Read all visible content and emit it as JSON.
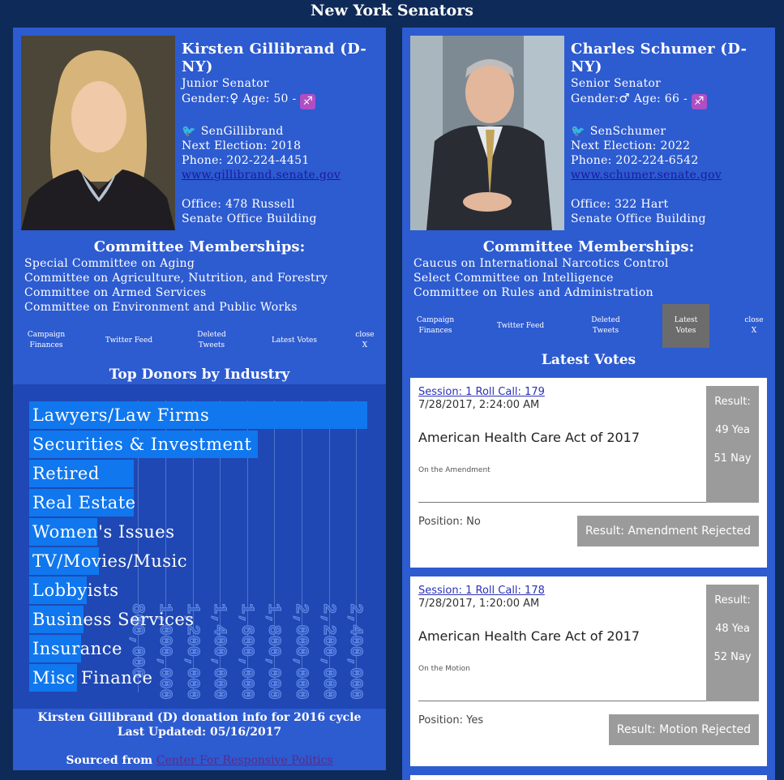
{
  "page_title": "New York Senators",
  "senators": [
    {
      "name": "Kirsten Gillibrand (D-NY)",
      "rank": "Junior Senator",
      "gender_label": "Gender:",
      "gender_symbol": "♀",
      "age_label": "Age: 50 -",
      "zodiac_symbol": "♐",
      "twitter_handle": "SenGillibrand",
      "next_election": "Next Election: 2018",
      "phone": "Phone: 202-224-4451",
      "website": "www.gillibrand.senate.gov",
      "office_line1": "Office: 478 Russell",
      "office_line2": "Senate Office Building",
      "committee_title": "Committee Memberships:",
      "committees": [
        "Special Committee on Aging",
        "Committee on Agriculture, Nutrition, and Forestry",
        "Committee on Armed Services",
        "Committee on Environment and Public Works"
      ],
      "tabs": [
        "Campaign Finances",
        "Twitter Feed",
        "Deleted Tweets",
        "Latest Votes",
        "close X"
      ],
      "section_title": "Top Donors by Industry",
      "footer_line1": "Kirsten Gillibrand (D) donation info for 2016 cycle",
      "footer_line2": "Last Updated: 05/16/2017",
      "sourced_label": "Sourced from",
      "sourced_link": "Center For Responsive Politics"
    },
    {
      "name": "Charles Schumer (D-NY)",
      "rank": "Senior Senator",
      "gender_label": "Gender:",
      "gender_symbol": "♂",
      "age_label": "Age: 66 -",
      "zodiac_symbol": "♐",
      "twitter_handle": "SenSchumer",
      "next_election": "Next Election: 2022",
      "phone": "Phone: 202-224-6542",
      "website": "www.schumer.senate.gov",
      "office_line1": "Office: 322 Hart",
      "office_line2": "Senate Office Building",
      "committee_title": "Committee Memberships:",
      "committees": [
        "Caucus on International Narcotics Control",
        "Select Committee on Intelligence",
        "Committee on Rules and Administration"
      ],
      "tabs": [
        "Campaign Finances",
        "Twitter Feed",
        "Deleted Tweets",
        "Latest Votes",
        "close X"
      ],
      "active_tab": "Latest Votes",
      "section_title": "Latest Votes",
      "votes": [
        {
          "session": "Session: 1 Roll Call: 179",
          "date": "7/28/2017, 2:24:00 AM",
          "bill": "American Health Care Act of 2017",
          "question": "On the Amendment",
          "result_label": "Result:",
          "yea": "49 Yea",
          "nay": "51 Nay",
          "position": "Position: No",
          "result": "Result: Amendment Rejected"
        },
        {
          "session": "Session: 1 Roll Call: 178",
          "date": "7/28/2017, 1:20:00 AM",
          "bill": "American Health Care Act of 2017",
          "question": "On the Motion",
          "result_label": "Result:",
          "yea": "48 Yea",
          "nay": "52 Nay",
          "position": "Position: Yes",
          "result": "Result: Motion Rejected"
        }
      ]
    }
  ],
  "chart_data": {
    "type": "bar",
    "orientation": "horizontal",
    "categories": [
      "Lawyers/Law Firms",
      "Securities & Investment",
      "Retired",
      "Real Estate",
      "Women's Issues",
      "TV/Movies/Music",
      "Lobbyists",
      "Business Services",
      "Insurance",
      "Misc Finance"
    ],
    "values": [
      2480000,
      1680000,
      770000,
      770000,
      500000,
      510000,
      420000,
      400000,
      380000,
      350000
    ],
    "tick_labels": [
      "800,000",
      "1,000,000",
      "1,200,000",
      "1,400,000",
      "1,600,000",
      "1,800,000",
      "2,000,000",
      "2,200,000",
      "2,400,000"
    ],
    "tick_values": [
      800000,
      1000000,
      1200000,
      1400000,
      1600000,
      1800000,
      2000000,
      2200000,
      2400000
    ],
    "xlim": [
      0,
      2500000
    ],
    "colors": {
      "bar": "#1077ee",
      "panel": "#1f48b4"
    }
  }
}
